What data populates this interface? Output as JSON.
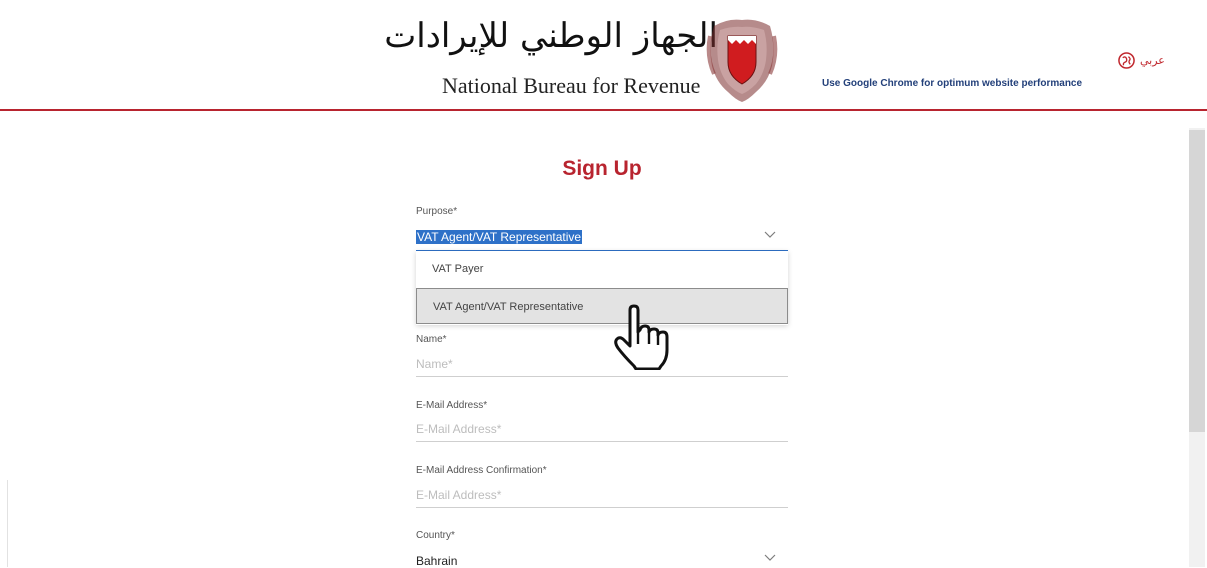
{
  "header": {
    "arabic_title": "الجهاز الوطني للإيرادات",
    "english_title": "National Bureau for Revenue",
    "browser_note": "Use Google Chrome for optimum website performance",
    "language_label": "عربي",
    "globe_icon": "globe-icon"
  },
  "form": {
    "title": "Sign Up",
    "purpose": {
      "label": "Purpose*",
      "selected": "VAT Agent/VAT Representative",
      "options": [
        "VAT Payer",
        "VAT Agent/VAT Representative"
      ]
    },
    "name": {
      "label": "Name*",
      "placeholder": "Name*"
    },
    "email": {
      "label": "E-Mail Address*",
      "placeholder": "E-Mail Address*"
    },
    "email_confirm": {
      "label": "E-Mail Address Confirmation*",
      "placeholder": "E-Mail Address*"
    },
    "country": {
      "label": "Country*",
      "value": "Bahrain"
    }
  },
  "colors": {
    "brand_red": "#b8242f",
    "note_blue": "#23407a",
    "selection_blue": "#2e71c8"
  },
  "icons": [
    "bahrain-crest-icon",
    "globe-icon",
    "chevron-down-icon",
    "hand-pointer-icon"
  ]
}
